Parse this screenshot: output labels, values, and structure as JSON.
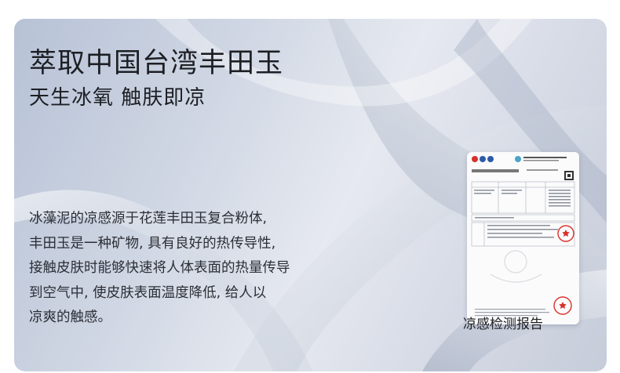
{
  "headline": {
    "title": "萃取中国台湾丰田玉",
    "subtitle": "天生冰氧  触肤即凉"
  },
  "description": {
    "lines": [
      "冰藻泥的凉感源于花莲丰田玉复合粉体,",
      "丰田玉是一种矿物, 具有良好的热传导性,",
      "接触皮肤时能够快速将人体表面的热量传导",
      "到空气中, 使皮肤表面温度降低, 给人以",
      "凉爽的触感。"
    ]
  },
  "report": {
    "caption": "凉感检测报告"
  },
  "colors": {
    "text_dark": "#1d1f24",
    "stamp_red": "#d8302a",
    "logo_blue": "#2d5aa8"
  }
}
